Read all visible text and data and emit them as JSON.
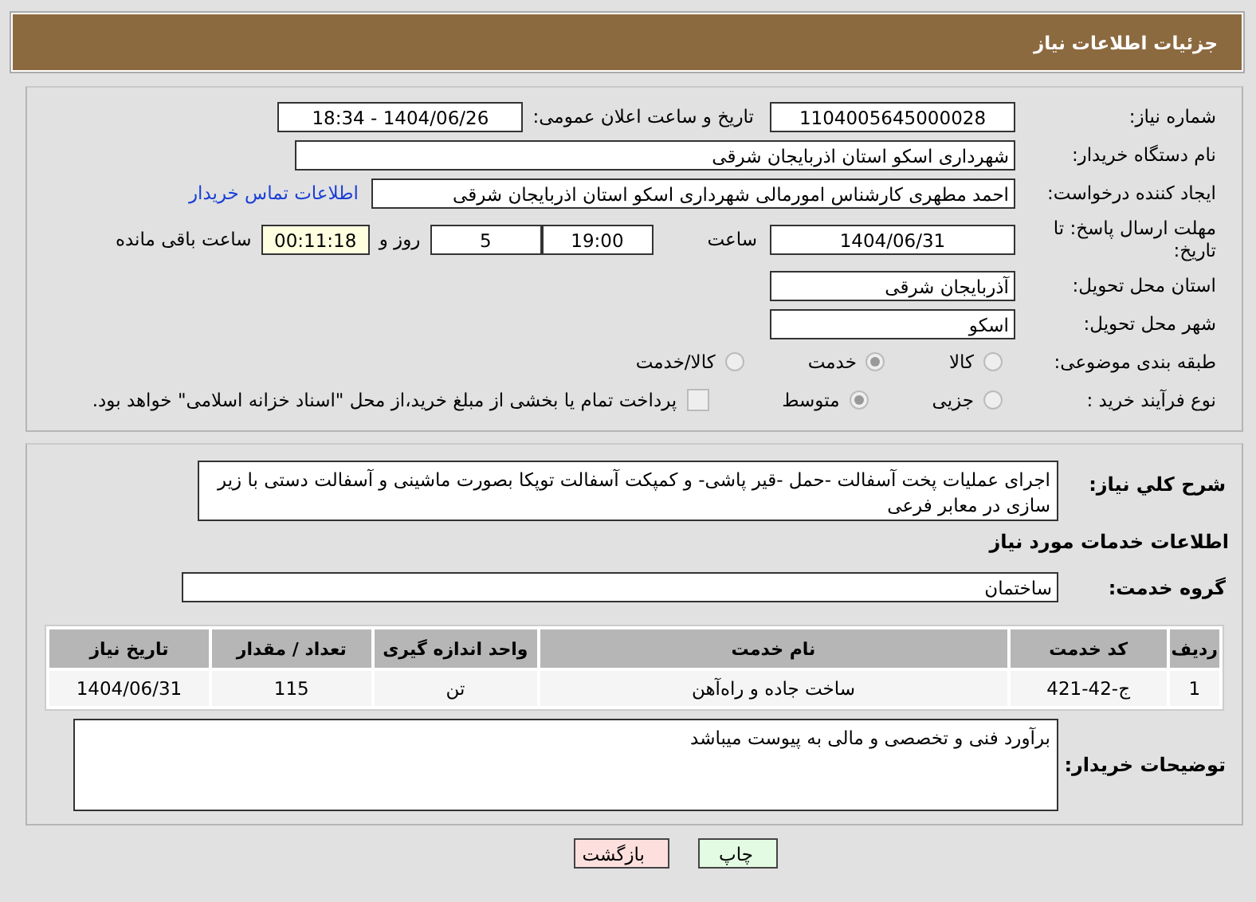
{
  "header": {
    "title": "جزئیات اطلاعات نیاز"
  },
  "need_number": {
    "label": "شماره نیاز:",
    "value": "1104005645000028"
  },
  "announce_datetime": {
    "label": "تاریخ و ساعت اعلان عمومی:",
    "value": "1404/06/26 - 18:34"
  },
  "buyer_org": {
    "label": "نام دستگاه خریدار:",
    "value": "شهرداری اسکو استان اذربایجان شرقی"
  },
  "requester": {
    "label": "ایجاد کننده درخواست:",
    "value": "احمد مطهری کارشناس امورمالی شهرداری اسکو استان اذربایجان شرقی",
    "link": "اطلاعات تماس خریدار"
  },
  "deadline": {
    "label": "مهلت ارسال پاسخ: تا تاریخ:",
    "date": "1404/06/31",
    "time_label": "ساعت",
    "time": "19:00",
    "days": "5",
    "days_label": "روز و",
    "remaining": "00:11:18",
    "remaining_label": "ساعت باقی مانده"
  },
  "province": {
    "label": "استان محل تحویل:",
    "value": "آذربایجان شرقی"
  },
  "city": {
    "label": "شهر محل تحویل:",
    "value": "اسکو"
  },
  "classification": {
    "label": "طبقه بندی موضوعی:",
    "options": [
      {
        "label": "کالا",
        "selected": false
      },
      {
        "label": "خدمت",
        "selected": true
      },
      {
        "label": "کالا/خدمت",
        "selected": false
      }
    ]
  },
  "process": {
    "label": "نوع فرآیند خرید :",
    "options": [
      {
        "label": "جزیی",
        "selected": false
      },
      {
        "label": "متوسط",
        "selected": true
      }
    ],
    "payment_checkbox": {
      "checked": false,
      "label": "پرداخت تمام یا بخشی از مبلغ خرید،از محل \"اسناد خزانه اسلامی\" خواهد بود."
    }
  },
  "description": {
    "label": "شرح کلي نياز:",
    "value": "اجرای عملیات پخت آسفالت -حمل -قیر پاشی- و کمپکت آسفالت توپکا بصورت ماشینی و آسفالت دستی با زیر سازی در معابر فرعی"
  },
  "services_heading": "اطلاعات خدمات مورد نیاز",
  "service_group": {
    "label": "گروه خدمت:",
    "value": "ساختمان"
  },
  "table": {
    "columns": [
      "ردیف",
      "کد خدمت",
      "نام خدمت",
      "واحد اندازه گیری",
      "تعداد / مقدار",
      "تاریخ نیاز"
    ],
    "rows": [
      [
        "1",
        "ج-42-421",
        "ساخت جاده و راه‌آهن",
        "تن",
        "115",
        "1404/06/31"
      ]
    ]
  },
  "buyer_notes": {
    "label": "توضیحات خریدار:",
    "value": "برآورد فنی و تخصصی و مالی به پیوست میباشد"
  },
  "buttons": [
    {
      "label": "چاپ",
      "kind": "print"
    },
    {
      "label": "بازگشت",
      "kind": "back"
    }
  ]
}
